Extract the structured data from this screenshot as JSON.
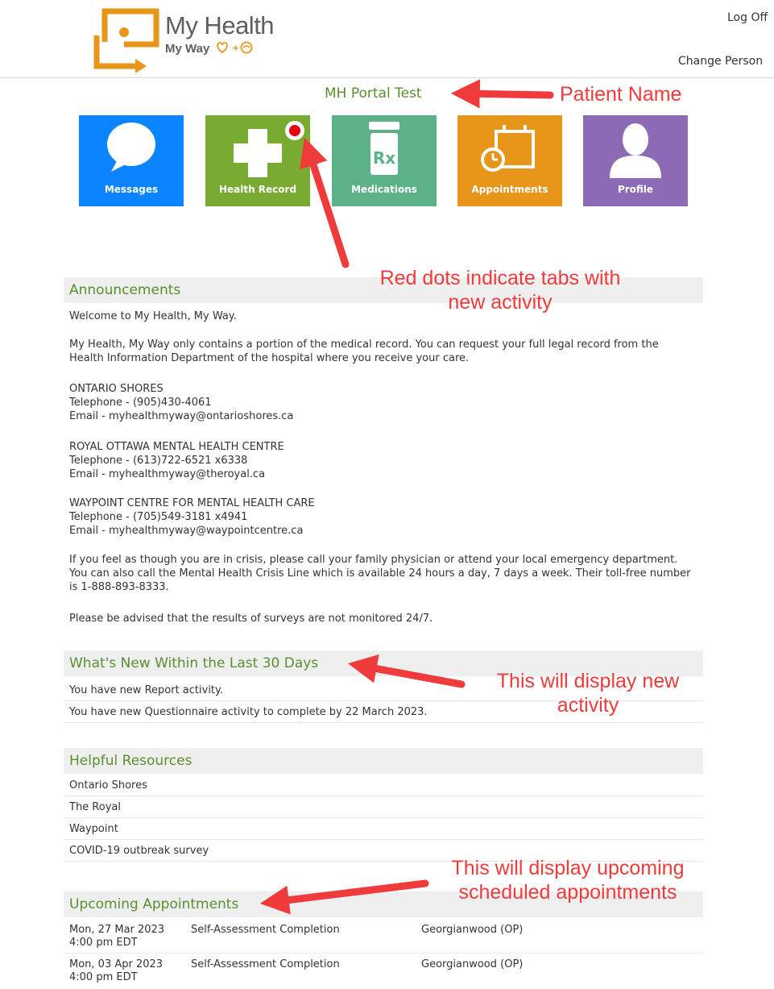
{
  "header": {
    "app_title": "My Health",
    "app_subtitle": "My Way",
    "logoff_label": "Log Off",
    "change_person_label": "Change Person",
    "patient_name": "MH Portal Test"
  },
  "tiles": [
    {
      "label": "Messages",
      "color": "#0a84ff",
      "icon": "speech-bubble-icon",
      "new_activity": false
    },
    {
      "label": "Health Record",
      "color": "#7aab31",
      "icon": "medical-cross-icon",
      "new_activity": true
    },
    {
      "label": "Medications",
      "color": "#5db186",
      "icon": "pill-bottle-rx-icon",
      "new_activity": false
    },
    {
      "label": "Appointments",
      "color": "#e8961a",
      "icon": "calendar-clock-icon",
      "new_activity": false
    },
    {
      "label": "Profile",
      "color": "#8c6ab5",
      "icon": "person-silhouette-icon",
      "new_activity": false
    }
  ],
  "announcements": {
    "title": "Announcements",
    "welcome": "Welcome to My Health, My Way.",
    "intro": "My Health, My Way only contains a portion of the medical record. You can request your full legal record from the Health Information Department of the hospital where you receive your care.",
    "contacts": [
      {
        "name": "ONTARIO SHORES",
        "phone": "Telephone - (905)430-4061",
        "email": "Email - myhealthmyway@ontarioshores.ca"
      },
      {
        "name": "ROYAL OTTAWA MENTAL HEALTH CENTRE",
        "phone": "Telephone - (613)722-6521 x6338",
        "email": "Email - myhealthmyway@theroyal.ca"
      },
      {
        "name": "WAYPOINT CENTRE FOR MENTAL HEALTH CARE",
        "phone": "Telephone - (705)549-3181 x4941",
        "email": "Email - myhealthmyway@waypointcentre.ca"
      }
    ],
    "crisis": "If you feel as though you are in crisis, please call your family physician or attend your local emergency department. You can also call the Mental Health Crisis Line which is available 24 hours a day, 7 days a week. Their toll-free number is 1-888-893-8333.",
    "surveys": "Please be advised that the results of surveys are not monitored 24/7."
  },
  "whats_new": {
    "title": "What's New Within the Last 30 Days",
    "items": [
      "You have new Report activity.",
      "You have new Questionnaire activity to complete by 22 March 2023."
    ]
  },
  "resources": {
    "title": "Helpful Resources",
    "items": [
      "Ontario Shores",
      "The Royal",
      "Waypoint",
      "COVID-19 outbreak survey"
    ]
  },
  "appointments": {
    "title": "Upcoming Appointments",
    "items": [
      {
        "date": "Mon, 27 Mar 2023",
        "time": "4:00 pm EDT",
        "type": "Self-Assessment Completion",
        "location": "Georgianwood (OP)"
      },
      {
        "date": "Mon, 03 Apr 2023",
        "time": "4:00 pm EDT",
        "type": "Self-Assessment Completion",
        "location": "Georgianwood (OP)"
      }
    ]
  },
  "annotations": {
    "patient_name": "Patient Name",
    "red_dots_line1": "Red dots indicate tabs with",
    "red_dots_line2": "new activity",
    "new_activity_line1": "This will display new",
    "new_activity_line2": "activity",
    "upcoming_line1": "This will display upcoming",
    "upcoming_line2": "scheduled appointments",
    "arrow_color": "#ef3b3b"
  }
}
